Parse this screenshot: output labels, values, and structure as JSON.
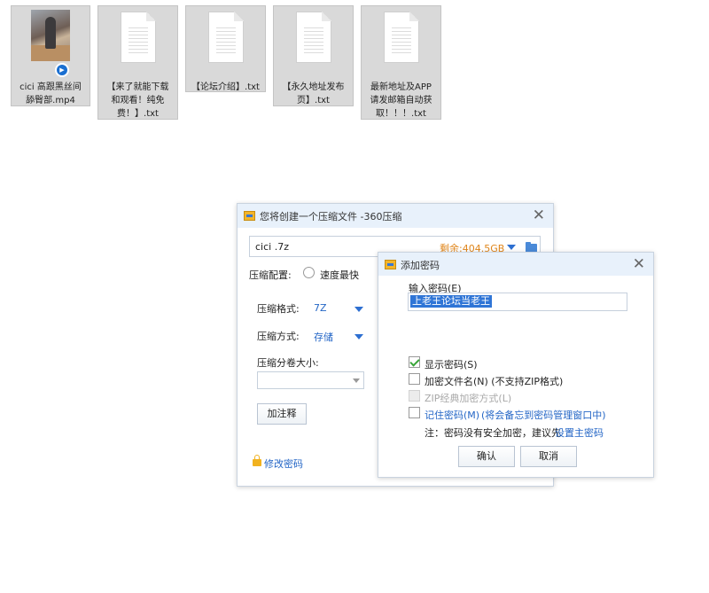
{
  "files": [
    {
      "name": "cici 高跟黑丝间舔臀部.mp4",
      "line1": "cici 高跟黑丝间",
      "line2": "舔臀部.mp4",
      "type": "video"
    },
    {
      "name": "【来了就能下载和观看！纯免费！】.txt",
      "line1": "【来了就能下载",
      "line2": "和观看！纯免",
      "line3": "费！】.txt",
      "type": "text"
    },
    {
      "name": "【论坛介绍】.txt",
      "line1": "【论坛介绍】.txt",
      "type": "text"
    },
    {
      "name": "【永久地址发布页】.txt",
      "line1": "【永久地址发布",
      "line2": "页】.txt",
      "type": "text"
    },
    {
      "name": "最新地址及APP请发邮箱自动获取！！！.txt",
      "line1": "最新地址及APP",
      "line2": "请发邮箱自动获",
      "line3": "取！！！.txt",
      "type": "text"
    }
  ],
  "compress_dialog": {
    "title": "您将创建一个压缩文件 -360压缩",
    "filename": "cici .7z",
    "space_left": "剩余:404.5GB",
    "config_label": "压缩配置:",
    "speed_option": "速度最快",
    "format_label": "压缩格式:",
    "format_value": "7Z",
    "method_label": "压缩方式:",
    "method_value": "存储",
    "split_label": "压缩分卷大小:",
    "split_value": "",
    "comment_button": "加注释",
    "modify_password": "修改密码"
  },
  "password_dialog": {
    "title": "添加密码",
    "input_label": "输入密码(E)",
    "password_value": "上老王论坛当老王",
    "show_password": {
      "label": "显示密码(S)",
      "checked": true
    },
    "encrypt_filenames": {
      "label": "加密文件名(N) (不支持ZIP格式)",
      "checked": false
    },
    "zip_classic": {
      "label": "ZIP经典加密方式(L)",
      "checked": false,
      "disabled": true
    },
    "remember_password": {
      "label_link": "记住密码(M)",
      "label_note": "(将会备忘到密码管理窗口中)",
      "checked": false
    },
    "note": "注：密码没有安全加密，建议先",
    "note_link": "设置主密码",
    "ok_button": "确认",
    "cancel_button": "取消"
  },
  "colors": {
    "accent": "#2466c6",
    "title_bg": "#e8f1fb",
    "orange": "#e0861b",
    "selection": "#2f75d6"
  }
}
